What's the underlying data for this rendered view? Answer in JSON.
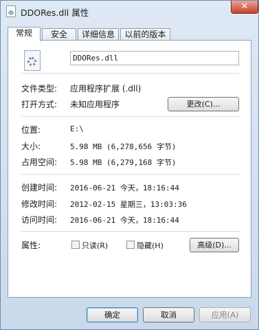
{
  "window": {
    "title": "DDORes.dll 属性",
    "close_glyph": "✕"
  },
  "tabs": [
    {
      "label": "常规",
      "active": true
    },
    {
      "label": "安全",
      "active": false
    },
    {
      "label": "详细信息",
      "active": false
    },
    {
      "label": "以前的版本",
      "active": false
    }
  ],
  "general": {
    "file_name": "DDORes.dll",
    "file_type_label": "文件类型:",
    "file_type_value": "应用程序扩展 (.dll)",
    "open_with_label": "打开方式:",
    "open_with_value": "未知应用程序",
    "change_button": "更改(C)...",
    "location_label": "位置:",
    "location_value": "E:\\",
    "size_label": "大小:",
    "size_value": "5.98 MB (6,278,656 字节)",
    "size_on_disk_label": "占用空间:",
    "size_on_disk_value": "5.98 MB (6,279,168 字节)",
    "created_label": "创建时间:",
    "created_value": "2016-06-21 今天，18:16:44",
    "modified_label": "修改时间:",
    "modified_value": "2012-02-15 星期三，13:03:36",
    "accessed_label": "访问时间:",
    "accessed_value": "2016-06-21 今天，18:16:44",
    "attributes_label": "属性:",
    "readonly_label": "只读(R)",
    "readonly_checked": false,
    "hidden_label": "隐藏(H)",
    "hidden_checked": false,
    "advanced_button": "高级(D)..."
  },
  "footer": {
    "ok": "确定",
    "cancel": "取消",
    "apply": "应用(A)"
  }
}
